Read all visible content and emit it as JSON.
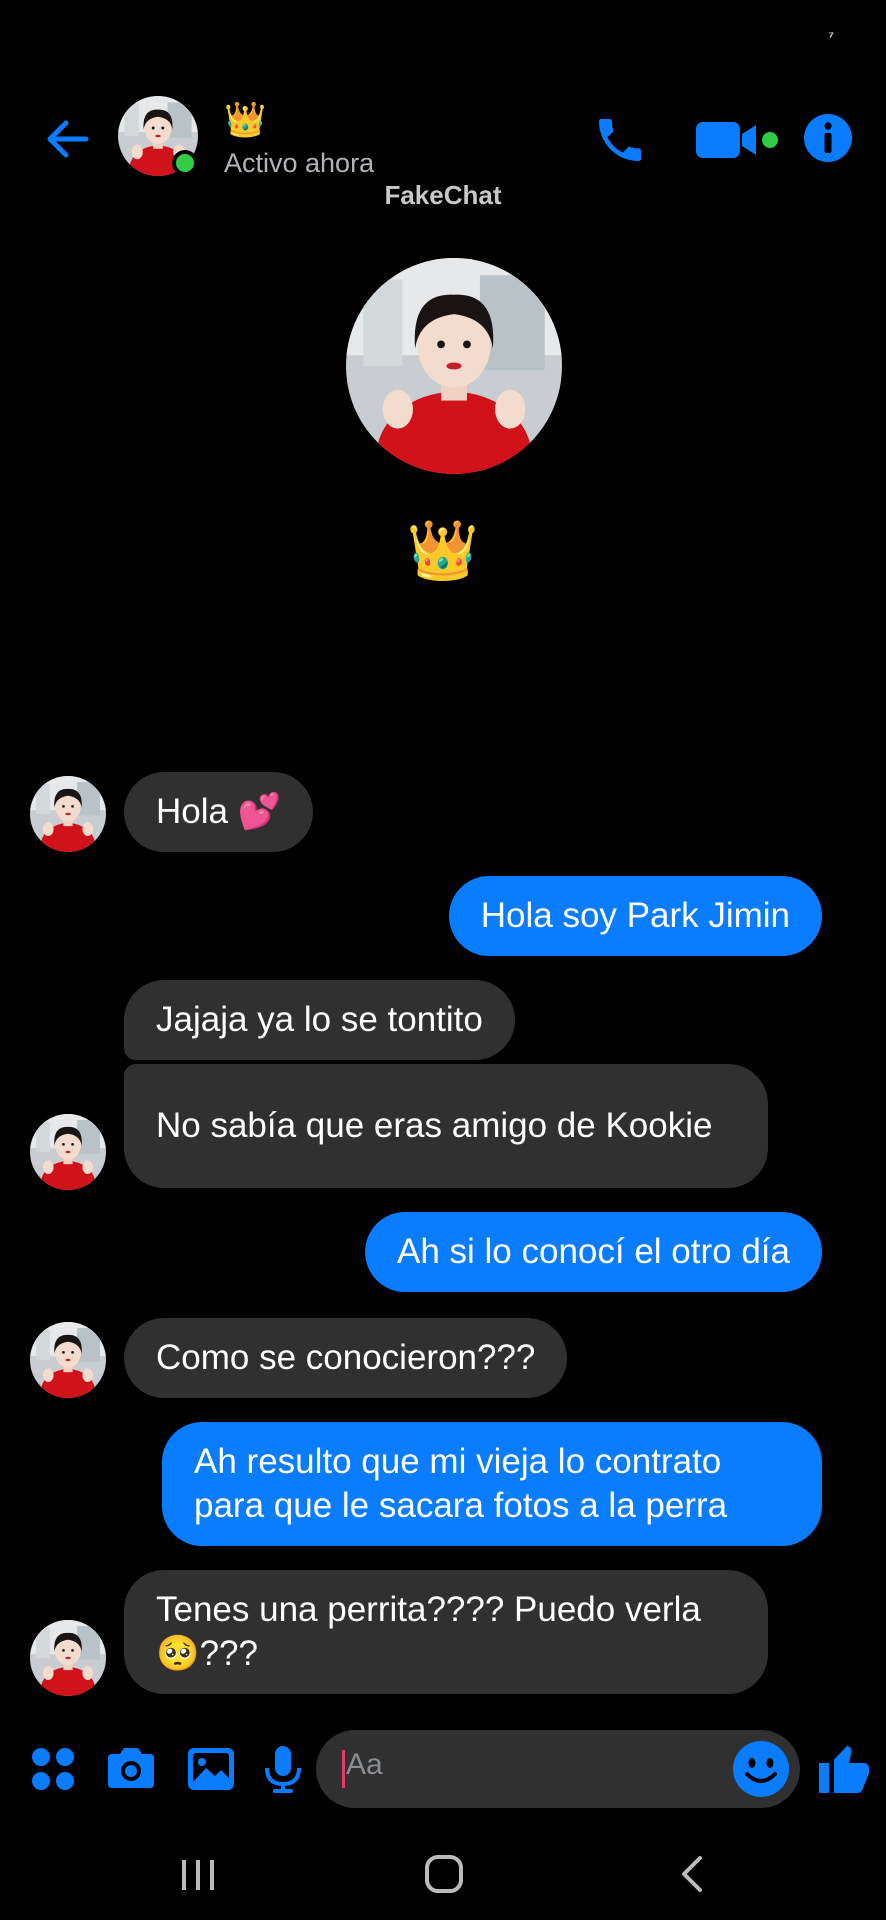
{
  "status_bar": {
    "indicator": "⁷"
  },
  "header": {
    "contact_name": "👑",
    "status": "Activo ahora",
    "watermark": "FakeChat"
  },
  "profile": {
    "name": "👑"
  },
  "messages": [
    {
      "side": "in",
      "text": "Hola 💕"
    },
    {
      "side": "out",
      "text": "Hola soy Park Jimin"
    },
    {
      "side": "in",
      "text": "Jajaja ya lo se tontito"
    },
    {
      "side": "in",
      "text": "No sabía que eras amigo de Kookie"
    },
    {
      "side": "out",
      "text": "Ah si lo conocí el otro día"
    },
    {
      "side": "in",
      "text": "Como se conocieron???"
    },
    {
      "side": "out",
      "text": "Ah resulto que mi vieja lo contrato para que le sacara fotos a la perra"
    },
    {
      "side": "in",
      "text": "Tenes una perrita???? Puedo verla 🥺???"
    }
  ],
  "composer": {
    "placeholder": "Aa"
  },
  "colors": {
    "accent": "#0a7cff",
    "incoming_bubble": "#303030",
    "online": "#31cc46",
    "background": "#000000"
  },
  "icons": [
    "back-arrow-icon",
    "phone-icon",
    "video-camera-icon",
    "info-icon",
    "apps-grid-icon",
    "camera-icon",
    "gallery-icon",
    "microphone-icon",
    "emoji-icon",
    "thumbs-up-icon",
    "recent-apps-icon",
    "home-icon",
    "nav-back-icon"
  ]
}
